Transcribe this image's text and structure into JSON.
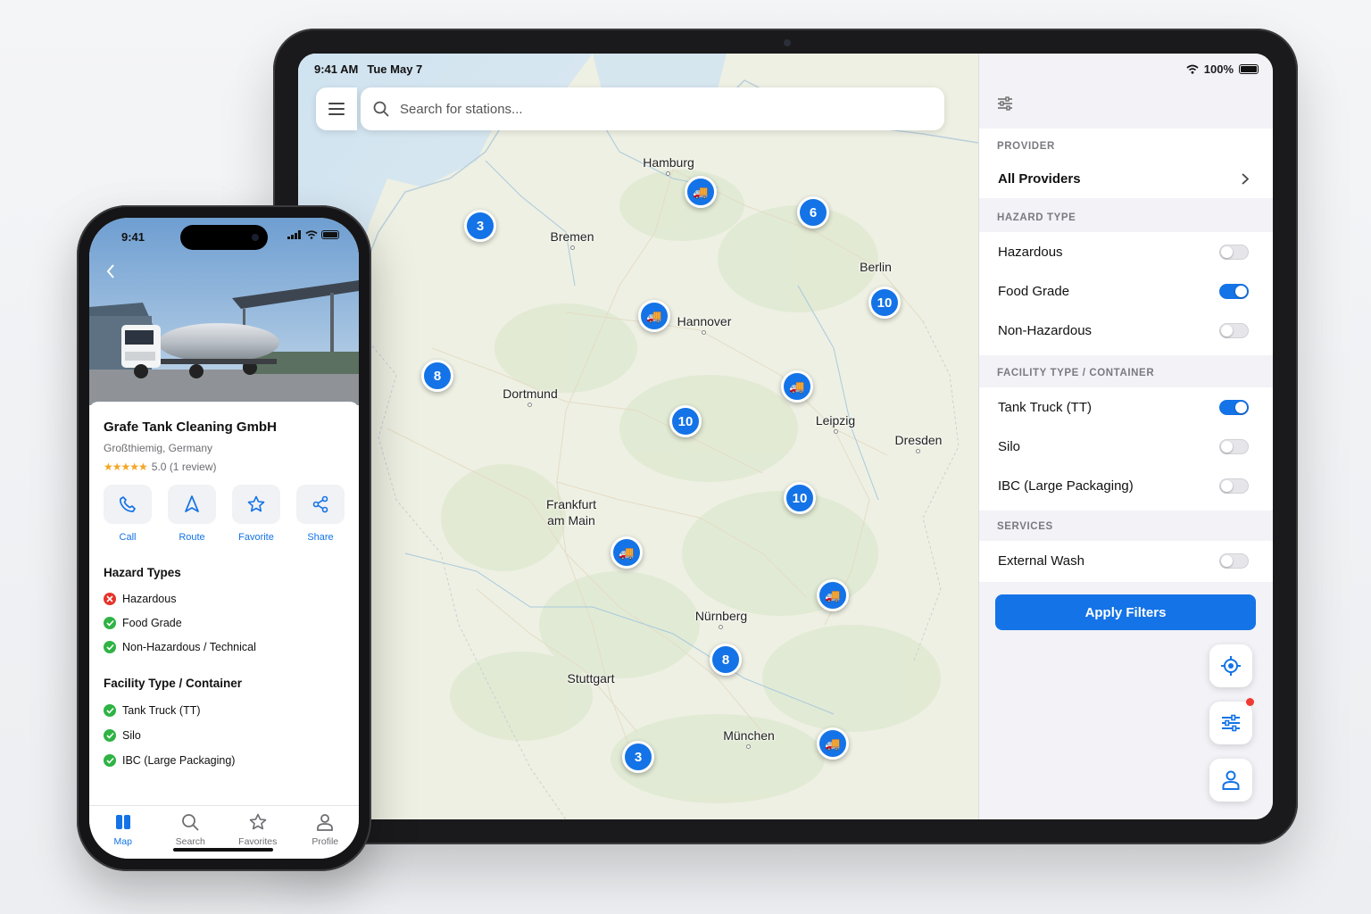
{
  "ipad": {
    "status": {
      "time": "9:41 AM",
      "date": "Tue May 7",
      "battery": "100%"
    },
    "search": {
      "placeholder": "Search for stations..."
    },
    "cities": [
      "Hamburg",
      "Bremen",
      "Berlin",
      "Hannover",
      "Dortmund",
      "Leipzig",
      "Dresden",
      "Frankfurt\nam Main",
      "Nürnberg",
      "Stuttgart",
      "München"
    ],
    "clusters": [
      "3",
      "6",
      "10",
      "8",
      "10",
      "10",
      "8",
      "3"
    ],
    "filters": {
      "provider_label": "PROVIDER",
      "provider_value": "All Providers",
      "hazard_label": "HAZARD TYPE",
      "hazard": [
        {
          "label": "Hazardous",
          "on": false
        },
        {
          "label": "Food Grade",
          "on": true
        },
        {
          "label": "Non-Hazardous",
          "on": false
        }
      ],
      "facility_label": "FACILITY TYPE / CONTAINER",
      "facility": [
        {
          "label": "Tank Truck (TT)",
          "on": true
        },
        {
          "label": "Silo",
          "on": false
        },
        {
          "label": "IBC (Large Packaging)",
          "on": false
        }
      ],
      "services_label": "SERVICES",
      "services": [
        {
          "label": "External Wash",
          "on": false
        }
      ],
      "apply_label": "Apply Filters"
    },
    "accent_color": "#1473e6"
  },
  "phone": {
    "status": {
      "time": "9:41"
    },
    "station": {
      "name": "Grafe Tank Cleaning GmbH",
      "location": "Großthiemig, Germany",
      "rating": "5.0 (1 review)"
    },
    "actions": [
      "Call",
      "Route",
      "Favorite",
      "Share"
    ],
    "hazard_title": "Hazard Types",
    "hazards": [
      {
        "label": "Hazardous",
        "ok": false
      },
      {
        "label": "Food Grade",
        "ok": true
      },
      {
        "label": "Non-Hazardous / Technical",
        "ok": true
      }
    ],
    "facility_title": "Facility Type / Container",
    "facilities": [
      {
        "label": "Tank Truck (TT)",
        "ok": true
      },
      {
        "label": "Silo",
        "ok": true
      },
      {
        "label": "IBC (Large Packaging)",
        "ok": true
      }
    ],
    "tabs": [
      "Map",
      "Search",
      "Favorites",
      "Profile"
    ]
  }
}
